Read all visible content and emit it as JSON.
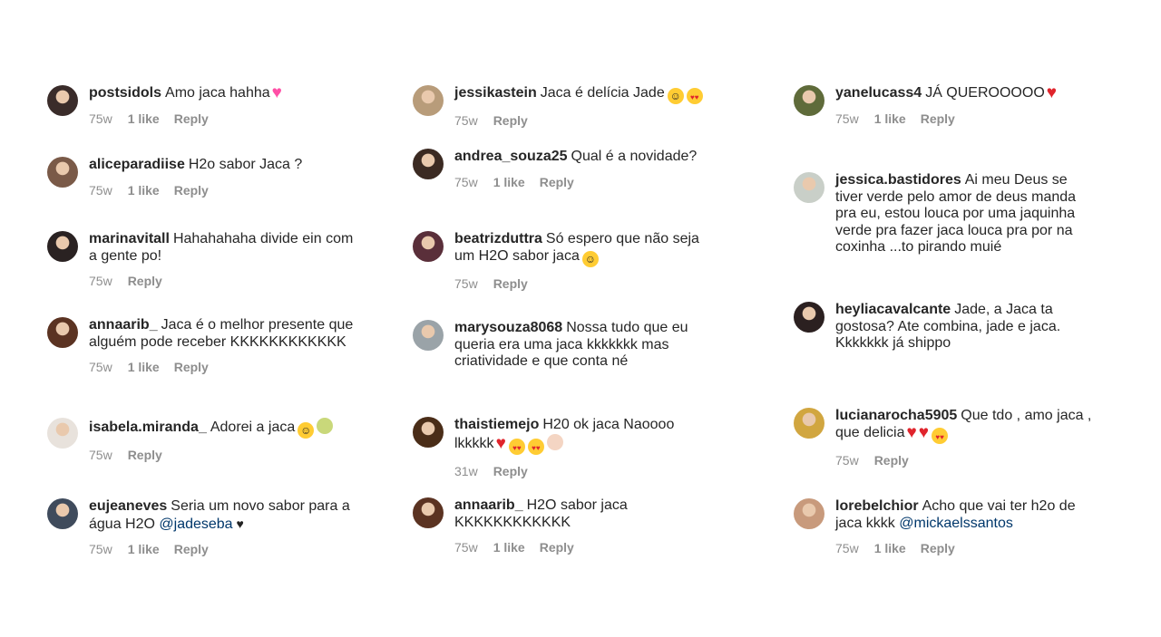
{
  "columns": [
    {
      "comments": [
        {
          "user": "postsidols",
          "text": "Amo jaca hahha",
          "emoji": [
            "pink-heart"
          ],
          "time": "75w",
          "likes": "1 like",
          "reply": "Reply",
          "avatar_color": "#3a2c2a"
        },
        {
          "user": "aliceparadiise",
          "text": "H2o sabor Jaca ?",
          "emoji": [],
          "time": "75w",
          "likes": "1 like",
          "reply": "Reply",
          "avatar_color": "#7a5a48"
        },
        {
          "user": "marinavitall",
          "text": "Hahahahaha divide ein com a gente po!",
          "emoji": [],
          "time": "75w",
          "likes": "",
          "reply": "Reply",
          "avatar_color": "#2a2222"
        },
        {
          "user": "annaarib_",
          "text": "Jaca é o melhor presente que alguém pode receber KKKKKKKKKKKK",
          "emoji": [],
          "time": "75w",
          "likes": "1 like",
          "reply": "Reply",
          "avatar_color": "#5b3322"
        },
        {
          "user": "isabela.miranda_",
          "text": "Adorei a jaca",
          "emoji": [
            "laugh",
            "melon"
          ],
          "time": "75w",
          "likes": "",
          "reply": "Reply",
          "avatar_color": "#e8e2dc"
        },
        {
          "user": "eujeaneves",
          "text": "Seria um novo sabor para a água H2O",
          "mention": "@jadeseba",
          "trail": "black-heart",
          "time": "75w",
          "likes": "1 like",
          "reply": "Reply",
          "avatar_color": "#3f4b5c"
        }
      ]
    },
    {
      "comments": [
        {
          "user": "jessikastein",
          "text": "Jaca é delícia Jade",
          "emoji": [
            "laugh",
            "heart-eyes"
          ],
          "time": "75w",
          "likes": "",
          "reply": "Reply",
          "avatar_color": "#b89c7a"
        },
        {
          "user": "andrea_souza25",
          "text": "Qual é a novidade?",
          "emoji": [],
          "time": "75w",
          "likes": "1 like",
          "reply": "Reply",
          "avatar_color": "#3b2a22"
        },
        {
          "user": "beatrizduttra",
          "text": "Só espero que não seja um H2O sabor jaca",
          "emoji": [
            "laugh"
          ],
          "time": "75w",
          "likes": "",
          "reply": "Reply",
          "avatar_color": "#5a2f3a"
        },
        {
          "user": "marysouza8068",
          "text": "Nossa tudo que eu queria era uma jaca kkkkkkk mas criatividade e que conta né",
          "emoji": [],
          "time": "",
          "likes": "",
          "reply": "",
          "avatar_color": "#9aa3a8"
        },
        {
          "user": "thaistiemejo",
          "text": "H20 ok jaca Naoooo lkkkkk",
          "emoji": [
            "heart",
            "heart-eyes",
            "heart-eyes",
            "girl"
          ],
          "time": "31w",
          "likes": "",
          "reply": "Reply",
          "avatar_color": "#4a2d18"
        },
        {
          "user": "annaarib_",
          "text": "H2O sabor jaca KKKKKKKKKKKK",
          "emoji": [],
          "time": "75w",
          "likes": "1 like",
          "reply": "Reply",
          "avatar_color": "#5b3322"
        }
      ]
    },
    {
      "comments": [
        {
          "user": "yanelucass4",
          "text": "JÁ QUEROOOOO",
          "emoji": [
            "heart"
          ],
          "time": "75w",
          "likes": "1 like",
          "reply": "Reply",
          "avatar_color": "#5f6b3a"
        },
        {
          "user": "jessica.bastidores",
          "text": "Ai meu Deus se tiver verde pelo amor de deus manda pra eu, estou louca por uma jaquinha verde pra fazer jaca louca pra por na coxinha ...to pirando muié",
          "emoji": [],
          "time": "",
          "likes": "",
          "reply": "",
          "avatar_color": "#c9cfc8"
        },
        {
          "user": "heyliacavalcante",
          "text": "Jade, a Jaca ta gostosa? Ate combina, jade e jaca. Kkkkkkk já shippo",
          "emoji": [],
          "time": "",
          "likes": "",
          "reply": "",
          "avatar_color": "#2b2020"
        },
        {
          "user": "lucianarocha5905",
          "text": "Que tdo , amo jaca , que delicia",
          "emoji": [
            "heart",
            "heart",
            "heart-eyes"
          ],
          "time": "75w",
          "likes": "",
          "reply": "Reply",
          "avatar_color": "#d1a640"
        },
        {
          "user": "lorebelchior",
          "text": "Acho que vai ter h2o de jaca kkkk",
          "mention": "@mickaelssantos",
          "time": "75w",
          "likes": "1 like",
          "reply": "Reply",
          "avatar_color": "#c89a7c"
        }
      ]
    }
  ]
}
